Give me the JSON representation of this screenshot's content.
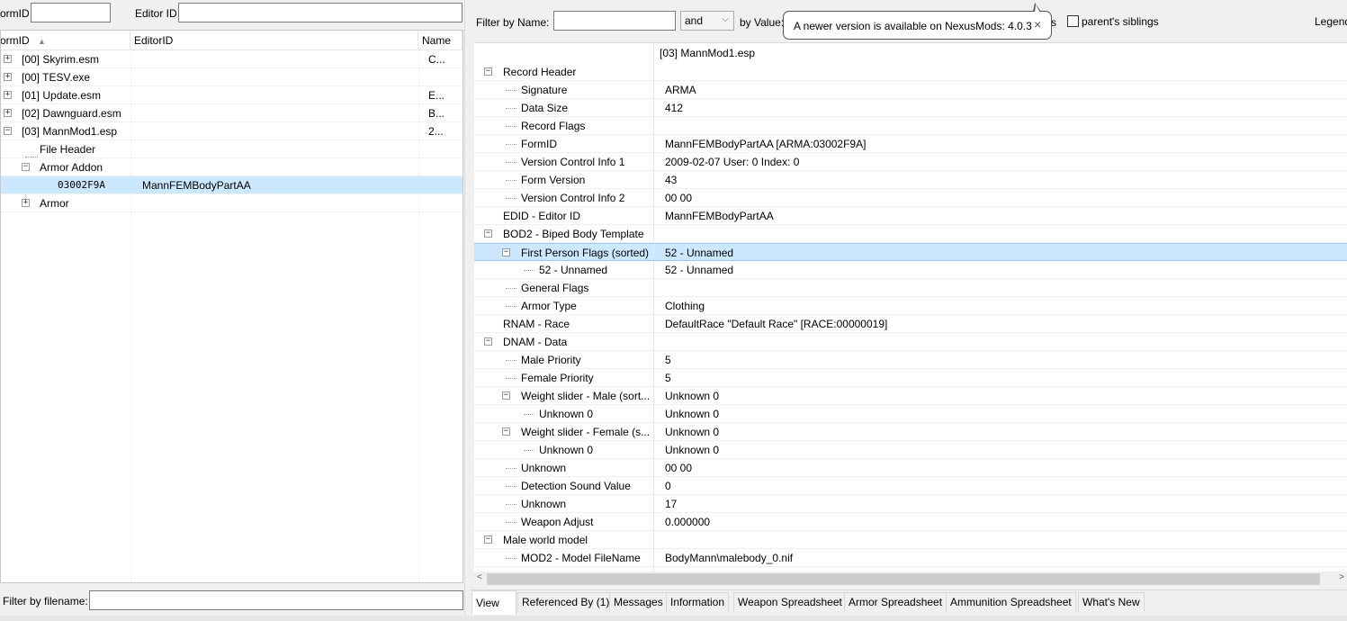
{
  "left_filters": {
    "formid_label": "ormID",
    "editorid_label": "Editor ID",
    "filename_label": "Filter by filename:"
  },
  "tree": {
    "headers": {
      "formid": "ormID",
      "editorid": "EditorID",
      "name": "Name"
    },
    "rows": [
      {
        "label": "[00] Skyrim.esm",
        "name": "C...",
        "expander": "+"
      },
      {
        "label": "[00] TESV.exe",
        "name": "",
        "expander": "+"
      },
      {
        "label": "[01] Update.esm",
        "name": "E...",
        "expander": "+"
      },
      {
        "label": "[02] Dawnguard.esm",
        "name": "B...",
        "expander": "+"
      },
      {
        "label": "[03] MannMod1.esp",
        "name": "2...",
        "expander": "−"
      },
      {
        "label": "File Header",
        "name": ""
      },
      {
        "label": "Armor Addon",
        "name": "",
        "expander": "−"
      },
      {
        "label": "03002F9A",
        "editorid": "MannFEMBodyPartAA",
        "name": ""
      },
      {
        "label": "Armor",
        "name": "",
        "expander": "+"
      }
    ]
  },
  "right_filter": {
    "filter_name_label": "Filter by Name:",
    "name_value": "",
    "operator": "and",
    "by_value_label": "by Value:",
    "partial_label": "s",
    "parents_siblings_label": "parent's siblings",
    "legend_label": "Legend"
  },
  "tooltip": {
    "text": "A newer version is available on NexusMods: 4.0.3",
    "close": "×"
  },
  "record_view": {
    "file_header": "[03] MannMod1.esp",
    "rows": [
      {
        "name": "Record Header",
        "value": "",
        "expander": "−"
      },
      {
        "name": "Signature",
        "value": "ARMA"
      },
      {
        "name": "Data Size",
        "value": "412"
      },
      {
        "name": "Record Flags",
        "value": ""
      },
      {
        "name": "FormID",
        "value": "MannFEMBodyPartAA [ARMA:03002F9A]"
      },
      {
        "name": "Version Control Info 1",
        "value": "2009-02-07 User: 0 Index: 0"
      },
      {
        "name": "Form Version",
        "value": "43"
      },
      {
        "name": "Version Control Info 2",
        "value": "00 00"
      },
      {
        "name": "EDID - Editor ID",
        "value": "MannFEMBodyPartAA"
      },
      {
        "name": "BOD2 - Biped Body Template",
        "value": "",
        "expander": "−"
      },
      {
        "name": "First Person Flags (sorted)",
        "value": "52 - Unnamed",
        "expander": "−"
      },
      {
        "name": "52 - Unnamed",
        "value": "52 - Unnamed"
      },
      {
        "name": "General Flags",
        "value": ""
      },
      {
        "name": "Armor Type",
        "value": "Clothing"
      },
      {
        "name": "RNAM - Race",
        "value": "DefaultRace \"Default Race\" [RACE:00000019]"
      },
      {
        "name": "DNAM - Data",
        "value": "",
        "expander": "−"
      },
      {
        "name": "Male Priority",
        "value": "5"
      },
      {
        "name": "Female Priority",
        "value": "5"
      },
      {
        "name": "Weight slider - Male (sort...",
        "value": "Unknown 0",
        "expander": "−"
      },
      {
        "name": "Unknown 0",
        "value": "Unknown 0"
      },
      {
        "name": "Weight slider - Female (s...",
        "value": "Unknown 0",
        "expander": "−"
      },
      {
        "name": "Unknown 0",
        "value": "Unknown 0"
      },
      {
        "name": "Unknown",
        "value": "00 00"
      },
      {
        "name": "Detection Sound Value",
        "value": "0"
      },
      {
        "name": "Unknown",
        "value": "17"
      },
      {
        "name": "Weapon Adjust",
        "value": "0.000000"
      },
      {
        "name": "Male world model",
        "value": "",
        "expander": "−"
      },
      {
        "name": "MOD2 - Model FileName",
        "value": "BodyMann\\malebody_0.nif"
      }
    ]
  },
  "tabs": [
    "View",
    "Referenced By (1)",
    "Messages",
    "Information",
    "Weapon Spreadsheet",
    "Armor Spreadsheet",
    "Ammunition Spreadsheet",
    "What's New"
  ],
  "scroll_arrows": {
    "left": "<",
    "right": ">"
  },
  "colors": {
    "selection": "#cce8ff",
    "window_bg": "#f0f0f0"
  }
}
